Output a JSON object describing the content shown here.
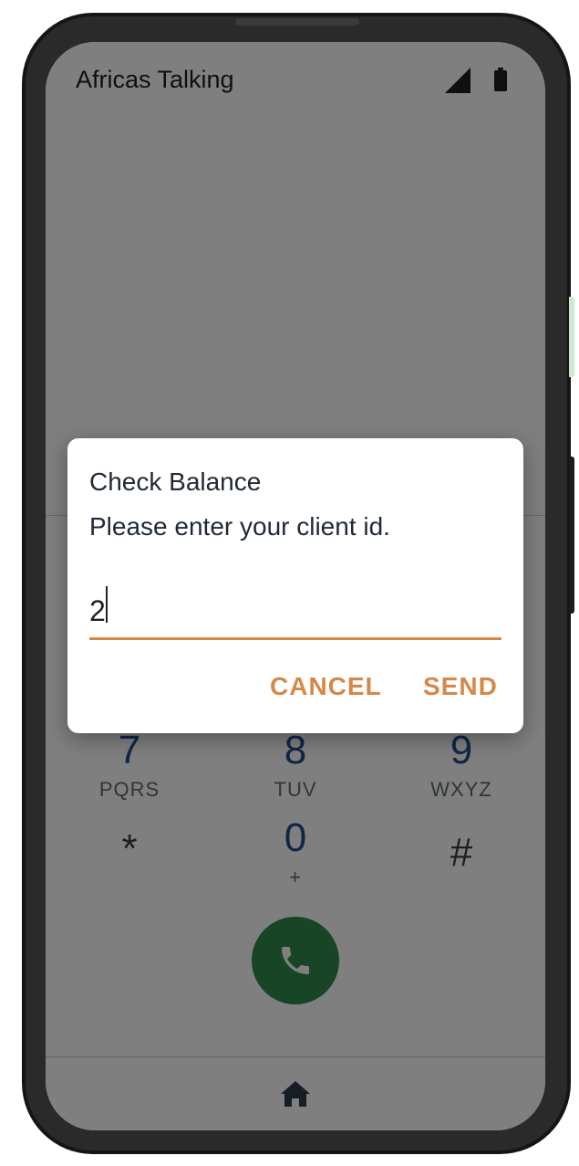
{
  "status_bar": {
    "title": "Africas Talking",
    "signal_icon": "signal-icon",
    "battery_icon": "battery-icon"
  },
  "keypad": {
    "visible_keys": [
      {
        "digit": "7",
        "letters": "PQRS"
      },
      {
        "digit": "8",
        "letters": "TUV"
      },
      {
        "digit": "9",
        "letters": "WXYZ"
      },
      {
        "digit": "*",
        "letters": ""
      },
      {
        "digit": "0",
        "letters": "+"
      },
      {
        "digit": "#",
        "letters": ""
      }
    ],
    "call_icon": "phone-icon"
  },
  "bottom_nav": {
    "home_icon": "home-icon"
  },
  "dialog": {
    "title": "Check Balance",
    "message": "Please enter your client id.",
    "input_value": "2",
    "cancel_label": "CANCEL",
    "send_label": "SEND"
  },
  "colors": {
    "accent": "#d4894a",
    "call_green": "#2e8b4a",
    "digit_blue": "#1f4e8c"
  }
}
